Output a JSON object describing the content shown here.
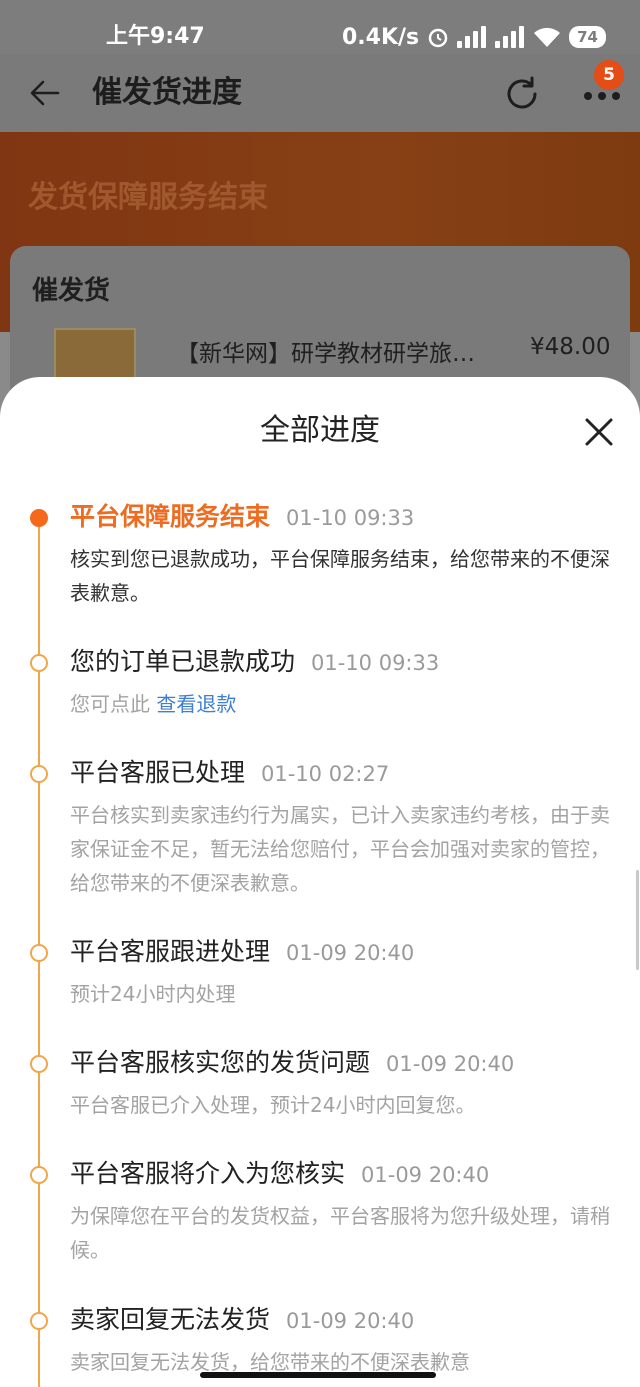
{
  "status_bar": {
    "time": "上午9:47",
    "speed": "0.4K/s",
    "battery": "74"
  },
  "header": {
    "title": "催发货进度",
    "badge_count": "5"
  },
  "hero": {
    "title": "发货保障服务结束"
  },
  "card": {
    "title": "催发货",
    "product_name": "【新华网】研学教材研学旅…",
    "price": "¥48.00"
  },
  "sheet": {
    "title": "全部进度",
    "events": [
      {
        "title": "平台保障服务结束",
        "time": "01-10 09:33",
        "desc": "核实到您已退款成功，平台保障服务结束，给您带来的不便深表歉意。",
        "active": true
      },
      {
        "title": "您的订单已退款成功",
        "time": "01-10 09:33",
        "desc": "您可点此 ",
        "link": "查看退款"
      },
      {
        "title": "平台客服已处理",
        "time": "01-10 02:27",
        "desc": "平台核实到卖家违约行为属实，已计入卖家违约考核，由于卖家保证金不足，暂无法给您赔付，平台会加强对卖家的管控，给您带来的不便深表歉意。"
      },
      {
        "title": "平台客服跟进处理",
        "time": "01-09 20:40",
        "desc": "预计24小时内处理"
      },
      {
        "title": "平台客服核实您的发货问题",
        "time": "01-09 20:40",
        "desc": "平台客服已介入处理，预计24小时内回复您。"
      },
      {
        "title": "平台客服将介入为您核实",
        "time": "01-09 20:40",
        "desc": "为保障您在平台的发货权益，平台客服将为您升级处理，请稍候。"
      },
      {
        "title": "卖家回复无法发货",
        "time": "01-09 20:40",
        "desc": "卖家回复无法发货，给您带来的不便深表歉意"
      }
    ]
  },
  "colors": {
    "accent": "#ee6c21",
    "timeline": "#f0a64c",
    "link": "#3f7fd0"
  }
}
